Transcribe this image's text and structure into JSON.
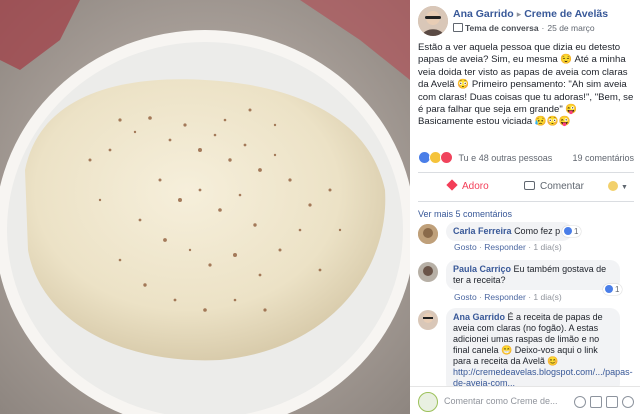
{
  "post": {
    "author": "Ana Garrido",
    "group": "Creme de Avelãs",
    "topic": "Tema de conversa",
    "date": "25 de março",
    "text": "Estão a ver aquela pessoa que dizia eu detesto papas de aveia? Sim, eu mesma 😌 Até a minha veia doida ter visto as papas de aveia com claras da Avelã 😳 Primeiro pensamento: \"Ah sim aveia com claras! Duas coisas que tu adoras!\", \"Bem, se é para falhar que seja em grande\" 😜 Basicamente estou viciada 😥😳😜",
    "reactions_text": "Tu e 48 outras pessoas",
    "comments_count": "19 comentários",
    "like_label": "Adoro",
    "comment_label": "Comentar"
  },
  "comments_section": {
    "see_more": "Ver mais 5 comentários",
    "items": [
      {
        "name": "Carla Ferreira",
        "text": "Como fez p",
        "like_label": "Gosto",
        "reply_label": "Responder",
        "time": "1 dia(s)",
        "reactions": "1"
      },
      {
        "name": "Paula Carriço",
        "text": "Eu também gostava de ter a receita?",
        "like_label": "Gosto",
        "reply_label": "Responder",
        "time": "1 dia(s)",
        "reactions": "1"
      },
      {
        "name": "Ana Garrido",
        "text": "É a receita de papas de aveia com claras (no fogão). A estas adicionei umas raspas de limão e no final canela 😁 Deixo-vos aqui o link para a receita da Avelã 😊",
        "link": "http://cremedeavelas.blogspot.com/.../papas-de-aveia-com...",
        "like_label": "",
        "reply_label": "",
        "time": "",
        "reactions": ""
      }
    ]
  },
  "composer": {
    "placeholder": "Comentar como Creme de..."
  },
  "colors": {
    "link": "#385898",
    "love": "#f33e58",
    "like": "#4a7ee8"
  }
}
